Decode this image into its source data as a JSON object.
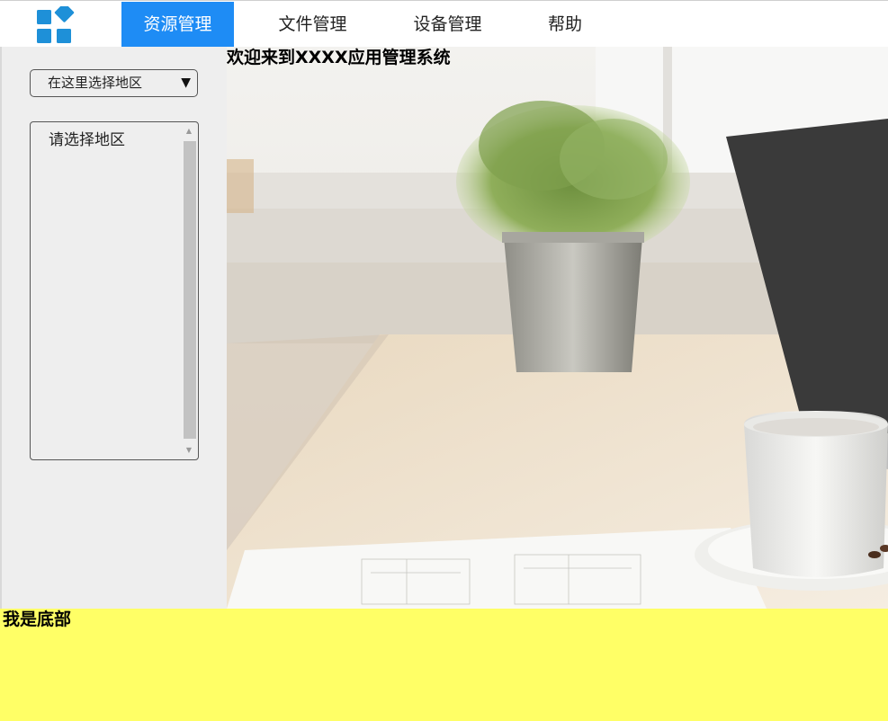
{
  "nav": {
    "items": [
      {
        "label": "资源管理",
        "active": true
      },
      {
        "label": "文件管理",
        "active": false
      },
      {
        "label": "设备管理",
        "active": false
      },
      {
        "label": "帮助",
        "active": false
      }
    ],
    "active_color": "#1e8cf5",
    "logo_icon": "app-grid-icon",
    "logo_color": "#1e90d8"
  },
  "sidebar": {
    "region_select": {
      "value": "在这里选择地区",
      "arrow_icon": "triangle-down-icon"
    },
    "region_list": {
      "items": [
        "请选择地区"
      ]
    }
  },
  "main": {
    "welcome": "欢迎来到XXXX应用管理系统",
    "background_image": "desk-with-plant-laptop-coffee-photo"
  },
  "footer": {
    "text": "我是底部",
    "background": "#ffff66"
  }
}
